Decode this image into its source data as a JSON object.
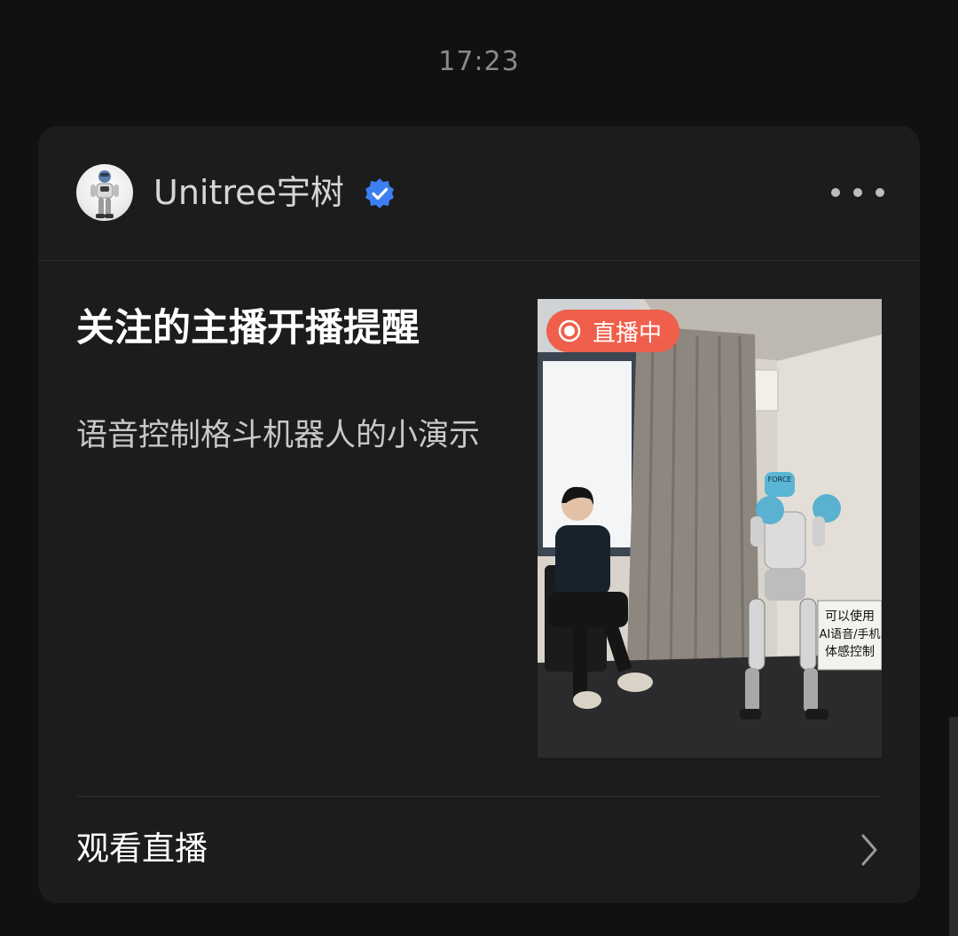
{
  "timestamp": "17:23",
  "card": {
    "account": {
      "name": "Unitree宇树",
      "verified": true,
      "avatar_icon": "robot-avatar-icon"
    },
    "title": "关注的主播开播提醒",
    "description": "语音控制格斗机器人的小演示",
    "thumbnail": {
      "live_badge": "直播中",
      "sign_lines": [
        "可以使用",
        "AI语音/手机",
        "体感控制"
      ],
      "robot_cap": "FORCE"
    },
    "action_label": "观看直播",
    "more_icon": "more-dots-icon",
    "chevron_icon": "chevron-right-icon"
  },
  "colors": {
    "background": "#111111",
    "card": "#1c1c1c",
    "live_badge": "#ef5f4b",
    "verified": "#3d7ff0"
  }
}
